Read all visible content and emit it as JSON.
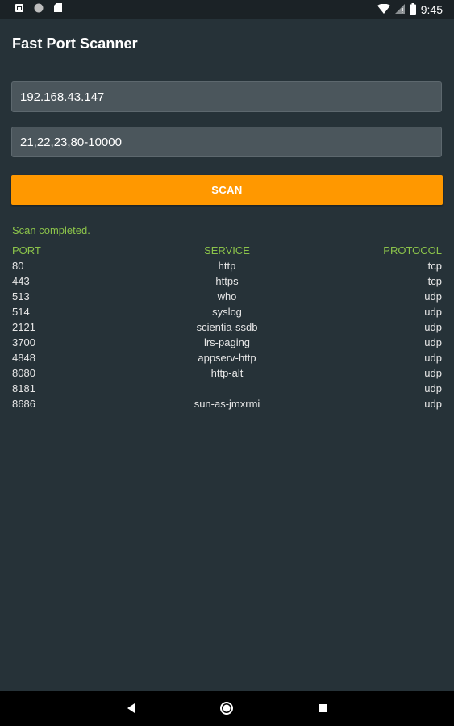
{
  "status_bar": {
    "time": "9:45",
    "icons": [
      "photo-notification-icon",
      "circle-notification-icon",
      "sd-card-icon",
      "wifi-icon",
      "no-signal-icon",
      "battery-icon"
    ]
  },
  "app": {
    "title": "Fast Port Scanner"
  },
  "form": {
    "ip_value": "192.168.43.147",
    "ports_value": "21,22,23,80-10000",
    "scan_label": "SCAN"
  },
  "results": {
    "status": "Scan completed.",
    "headers": {
      "port": "PORT",
      "service": "SERVICE",
      "protocol": "PROTOCOL"
    },
    "rows": [
      {
        "port": "80",
        "service": "http",
        "protocol": "tcp"
      },
      {
        "port": "443",
        "service": "https",
        "protocol": "tcp"
      },
      {
        "port": "513",
        "service": "who",
        "protocol": "udp"
      },
      {
        "port": "514",
        "service": "syslog",
        "protocol": "udp"
      },
      {
        "port": "2121",
        "service": "scientia-ssdb",
        "protocol": "udp"
      },
      {
        "port": "3700",
        "service": "lrs-paging",
        "protocol": "udp"
      },
      {
        "port": "4848",
        "service": "appserv-http",
        "protocol": "udp"
      },
      {
        "port": "8080",
        "service": "http-alt",
        "protocol": "udp"
      },
      {
        "port": "8181",
        "service": "",
        "protocol": "udp"
      },
      {
        "port": "8686",
        "service": "sun-as-jmxrmi",
        "protocol": "udp"
      }
    ]
  },
  "colors": {
    "background": "#263238",
    "accent": "#ff9800",
    "green_text": "#8bc34a",
    "field_bg": "#4b565c"
  },
  "nav_bar": {
    "icons": [
      "back-icon",
      "home-icon",
      "recents-icon"
    ]
  }
}
